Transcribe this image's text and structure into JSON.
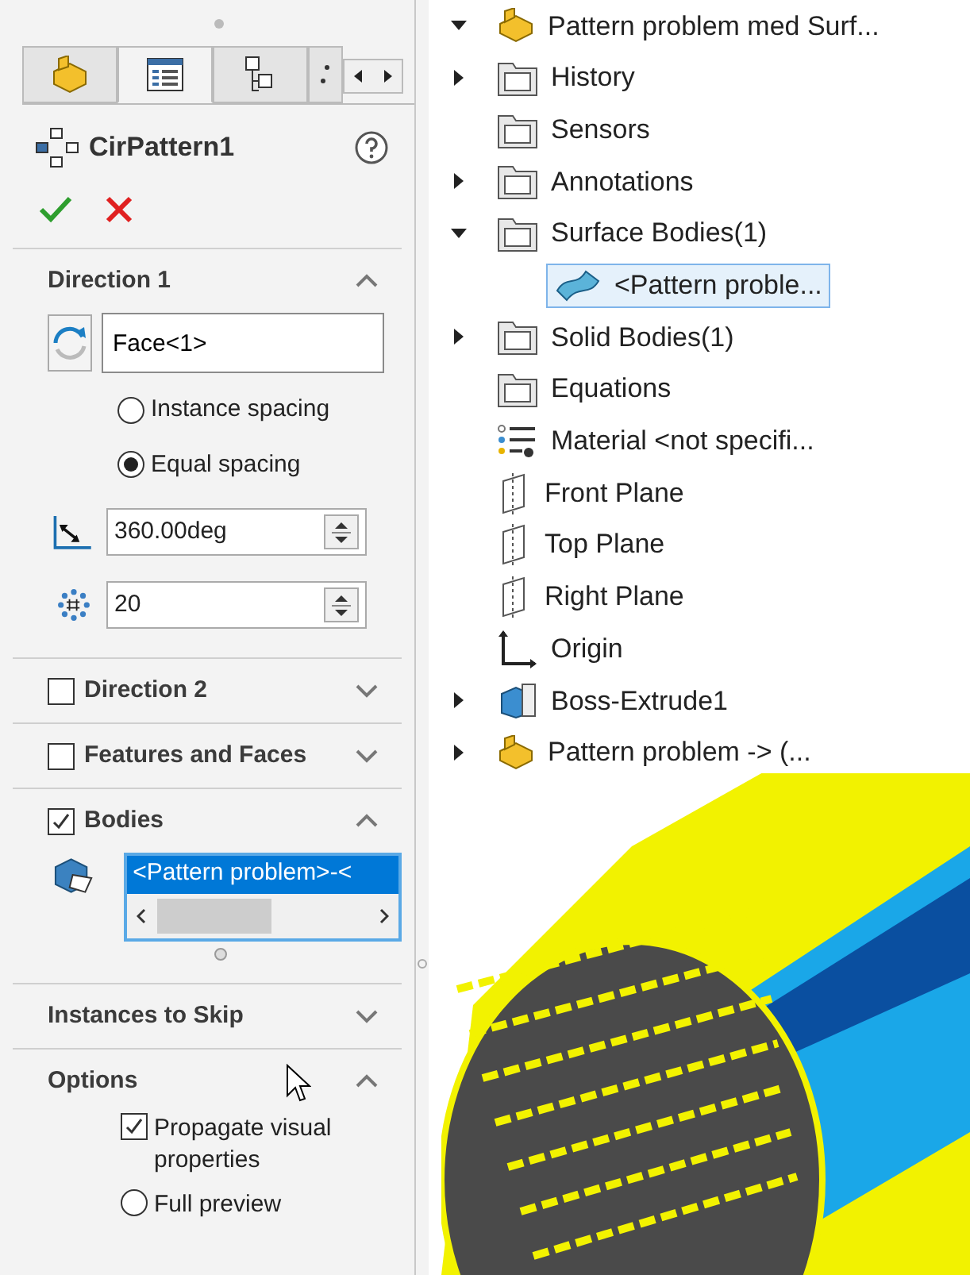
{
  "panel_tabs": [
    {
      "kind": "part",
      "selected": false
    },
    {
      "kind": "properties",
      "selected": true
    },
    {
      "kind": "config",
      "selected": false
    },
    {
      "kind": "more",
      "selected": false
    }
  ],
  "feature": {
    "title": "CirPattern1"
  },
  "sections": [
    {
      "kind": "direction1",
      "title": "Direction 1",
      "expanded": true,
      "axis_field": "Face<1>",
      "spacing": [
        {
          "label": "Instance spacing",
          "selected": false
        },
        {
          "label": "Equal spacing",
          "selected": true
        }
      ],
      "angle": "360.00deg",
      "count": "20"
    },
    {
      "kind": "check",
      "title": "Direction 2",
      "checked": false,
      "expanded": false
    },
    {
      "kind": "check",
      "title": "Features and Faces",
      "checked": false,
      "expanded": false
    },
    {
      "kind": "bodies",
      "title": "Bodies",
      "checked": true,
      "expanded": true,
      "list": [
        {
          "label": "<Pattern problem>-<",
          "selected": true
        }
      ]
    },
    {
      "kind": "plain",
      "title": "Instances to Skip",
      "expanded": false
    },
    {
      "kind": "options",
      "title": "Options",
      "expanded": true,
      "options": [
        {
          "kind": "checkbox",
          "label": "Propagate visual properties",
          "checked": true
        },
        {
          "kind": "radio",
          "label": "Full preview",
          "selected": false
        }
      ]
    }
  ],
  "tree": {
    "label": "Pattern problem med Surf...",
    "kind": "part",
    "expanded": true,
    "children": [
      {
        "label": "History",
        "kind": "folder",
        "expanded": false
      },
      {
        "label": "Sensors",
        "kind": "folder"
      },
      {
        "label": "Annotations",
        "kind": "folder",
        "expanded": false
      },
      {
        "label": "Surface Bodies(1)",
        "kind": "folder",
        "expanded": true,
        "children": [
          {
            "label": "<Pattern proble...",
            "kind": "surface",
            "selected": true
          }
        ]
      },
      {
        "label": "Solid Bodies(1)",
        "kind": "folder",
        "expanded": false
      },
      {
        "label": "Equations",
        "kind": "folder"
      },
      {
        "label": "Material <not specifi...",
        "kind": "material"
      },
      {
        "label": "Front Plane",
        "kind": "plane"
      },
      {
        "label": "Top Plane",
        "kind": "plane"
      },
      {
        "label": "Right Plane",
        "kind": "plane"
      },
      {
        "label": "Origin",
        "kind": "origin"
      },
      {
        "label": "Boss-Extrude1",
        "kind": "extrude",
        "expanded": false
      },
      {
        "label": "Pattern problem -> (...",
        "kind": "part",
        "expanded": false
      }
    ]
  }
}
